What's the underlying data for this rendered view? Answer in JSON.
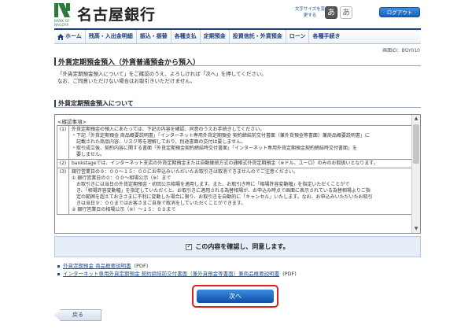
{
  "header": {
    "logo_text": "BANK OF NAGOYA",
    "bank_name": "名古屋銀行",
    "font_size_label": "文字サイズを変更する",
    "font_small": "あ",
    "font_large": "あ",
    "logout": "ログアウト"
  },
  "nav": {
    "items": [
      "ホーム",
      "残高・入出金明細",
      "振込・振替",
      "各種支払",
      "定期預金",
      "投資信託・外貨預金",
      "ローン",
      "各種手続き"
    ]
  },
  "screen_id": "画面ID：BGY010",
  "title": "外貨定期預金預入（外貨普通預金から預入）",
  "intro": {
    "line1": "「外貨定期預金預入について」をご確認のうえ、よろしければ「次へ」を押してください。",
    "line2": "なお、ご同意いただけない場合はお取引きいただけません。"
  },
  "section_title": "外貨定期預金預入について",
  "notice": {
    "heading": "<確認事項>",
    "items": [
      {
        "num": "(1)",
        "lines": [
          "外貨定期預金の預入にあたっては、下記の内容を確認、同意のうえお手続きしてください。",
          "・下記「外貨定期預金 商品概要説明書」「インターネット専用外貨定期預金 契約締結前交付書面（兼外貨預金等書面）兼商品概要説明書」に",
          "　記載された商品内容、リスク等を理解しており、別途書面の交付は要しません。",
          "・取引成立後、契約内容に関する書面「外貨定期預金契約締結時交付書面」「インターネット専用外貨定期預金契約締結時交付書面」を",
          "　要しません。"
        ]
      },
      {
        "num": "(2)",
        "lines": [
          "bankstageでは、インターネット支店の外貨定期預金または自動継続方式の通帳式外貨定期預金（※ドル、ユーロ）のみのお取扱いとなります。"
        ]
      },
      {
        "num": "(3)",
        "lines": [
          "銀行営業日の９：００～１５：００にお申込みいただいたお取引きは取消できませんのでご注意ください。",
          "① 銀行営業日の０：００～相場公示（※）まで",
          "　お取引きには当日の外貨定期預金・初回公示相場を適用します。また、お取引き時に「相場許容変動幅」を指定いただくことがで",
          "　き、「相場許容変動幅」を指定していただくと、お取引きに適用される為替相場が、お申込み時点で画面に表示されている為替相場よりご指",
          "　定の範囲を超えておきさまに不利に変動した場合に限り、お取引きを自動的に「キャンセル」いたします。なお、お申込みいただいたお取引",
          "　きは当日９：００まではお客さまご自身で取消をしていただくことができます。",
          "② 銀行営業日の相場公示（※）～１５：００まで"
        ]
      }
    ]
  },
  "confirm_label": "この内容を確認し、同意します。",
  "links": [
    {
      "text": "外貨定期預金 商品概要説明書",
      "suffix": "(PDF)"
    },
    {
      "text": "インターネット専用外貨定期預金 契約締結前交付書面（兼外貨預金等書面）兼商品概要説明書",
      "suffix": "(PDF)"
    }
  ],
  "next_button": "次へ",
  "back_button": "戻る",
  "colors": {
    "brand_green": "#2a7a3a",
    "nav_blue": "#1d3d7a",
    "button_blue": "#1a5fb8",
    "highlight_red": "#e02020"
  }
}
